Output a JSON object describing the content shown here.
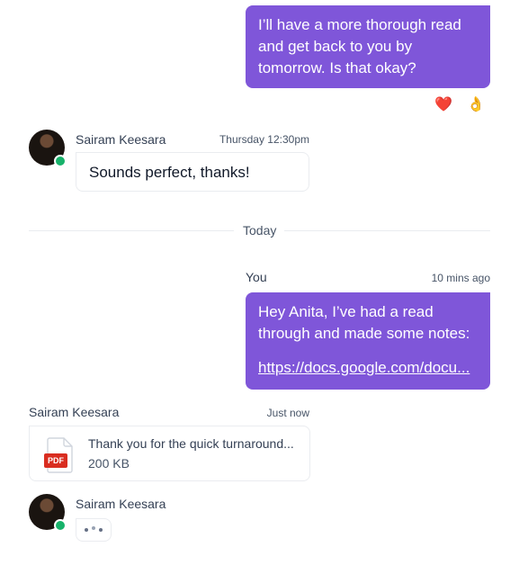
{
  "messages": {
    "outgoing_first": {
      "text": "I’ll have a more thorough read and get back to you by tomorrow. Is that okay?",
      "reactions": [
        "❤️",
        "👌"
      ]
    },
    "incoming_first": {
      "sender": "Sairam Keesara",
      "time": "Thursday 12:30pm",
      "text": "Sounds perfect, thanks!"
    },
    "divider": {
      "label": "Today"
    },
    "outgoing_second": {
      "sender": "You",
      "time": "10 mins ago",
      "text": "Hey Anita, I’ve had a read through and made some notes:",
      "link": "https://docs.google.com/docu..."
    },
    "incoming_file": {
      "sender": "Sairam Keesara",
      "time": "Just now",
      "file_name": "Thank you for the quick turnaround...",
      "file_size": "200 KB",
      "file_badge": "PDF"
    },
    "incoming_typing": {
      "sender": "Sairam Keesara"
    }
  },
  "colors": {
    "accent": "#7F56D9",
    "online": "#17B26A",
    "pdf": "#D92D20"
  }
}
